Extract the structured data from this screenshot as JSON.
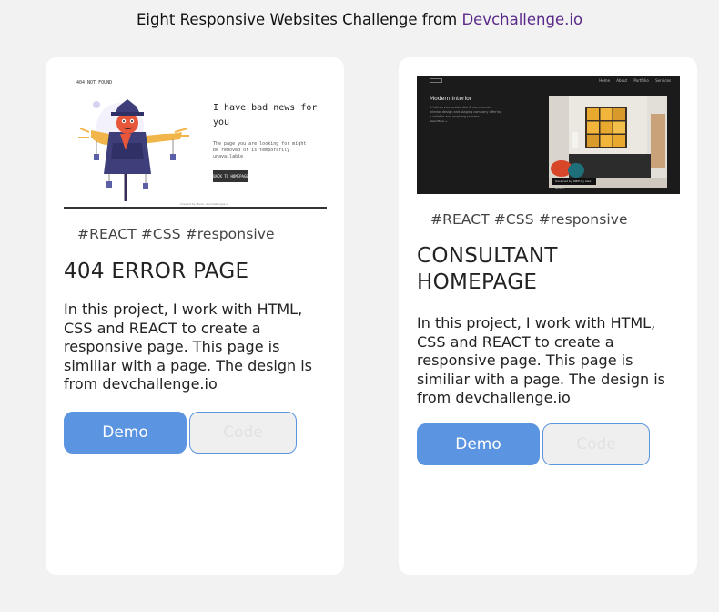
{
  "header": {
    "text": "Eight Responsive Websites Challenge from ",
    "link": "Devchallenge.io"
  },
  "projects": [
    {
      "tags": "#REACT #CSS #responsive",
      "title": "404 ERROR PAGE",
      "description": "In this project, I work with HTML, CSS and REACT to create a responsive page. This page is similiar with a page. The design is from devchallenge.io",
      "demo_label": "Demo",
      "code_label": "Code",
      "thumbnail": {
        "brand": "404 NOT FOUND",
        "headline": "I have bad news for you",
        "subtext": "The page you are looking for might be removed or is temporarily unavailable",
        "button": "BACK TO HOMEPAGE",
        "footer": "Created by Maria, devchallenges.io"
      }
    },
    {
      "tags": "#REACT #CSS #responsive",
      "title": "CONSULTANT HOMEPAGE",
      "description": "In this project, I work with HTML, CSS and REACT to create a responsive page. This page is similiar with a page. The design is from devchallenge.io",
      "demo_label": "Demo",
      "code_label": "Code",
      "thumbnail": {
        "nav": "Home About Portfolio Services",
        "hero_title": "Modern Interior",
        "hero_text": "A full-service residential & commercial interior design and staging company offering a reliable and inspiring process.",
        "hero_link": "Read More →",
        "caption": "Designed by 4MIH by Alex Walker"
      }
    }
  ],
  "colors": {
    "accent": "#5b94e0",
    "page_bg": "#f2f2f2",
    "card_bg": "#ffffff",
    "link": "#5a2a8a"
  }
}
